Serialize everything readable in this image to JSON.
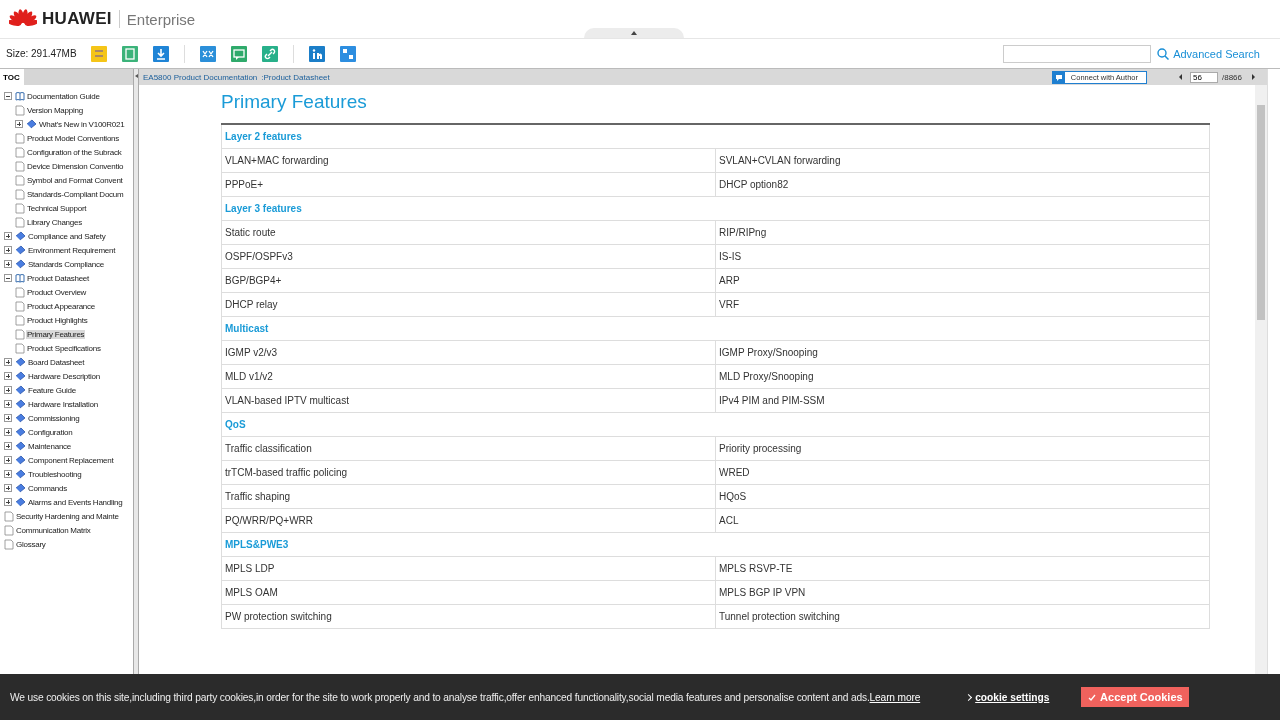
{
  "header": {
    "brand": "HUAWEI",
    "subtitle": "Enterprise"
  },
  "toolbar": {
    "size_label": "Size: 291.47MB",
    "advanced_search": "Advanced Search"
  },
  "toc": {
    "tab": "TOC",
    "items": [
      {
        "kind": "book",
        "label": "Documentation Guide",
        "expanded": true,
        "selected": false,
        "children": [
          {
            "kind": "page",
            "label": "Version Mapping",
            "selected": false
          },
          {
            "kind": "folder",
            "label": "What's New in V100R021",
            "expanded": false,
            "selected": false
          },
          {
            "kind": "page",
            "label": "Product Model Conventions",
            "selected": false
          },
          {
            "kind": "page",
            "label": "Configuration of the Subrack",
            "selected": false
          },
          {
            "kind": "page",
            "label": "Device Dimension Conventio",
            "selected": false
          },
          {
            "kind": "page",
            "label": "Symbol and Format Convent",
            "selected": false
          },
          {
            "kind": "page",
            "label": "Standards-Compliant Docum",
            "selected": false
          },
          {
            "kind": "page",
            "label": "Technical Support",
            "selected": false
          },
          {
            "kind": "page",
            "label": "Library Changes",
            "selected": false
          }
        ]
      },
      {
        "kind": "folder",
        "label": "Compliance and Safety",
        "expanded": false,
        "selected": false
      },
      {
        "kind": "folder",
        "label": "Environment Requirement",
        "expanded": false,
        "selected": false
      },
      {
        "kind": "folder",
        "label": "Standards Compliance",
        "expanded": false,
        "selected": false
      },
      {
        "kind": "book",
        "label": "Product Datasheet",
        "expanded": true,
        "selected": false,
        "children": [
          {
            "kind": "page",
            "label": "Product Overview",
            "selected": false
          },
          {
            "kind": "page",
            "label": "Product Appearance",
            "selected": false
          },
          {
            "kind": "page",
            "label": "Product Highlights",
            "selected": false
          },
          {
            "kind": "page",
            "label": "Primary Features",
            "selected": true
          },
          {
            "kind": "page",
            "label": "Product Specifications",
            "selected": false
          }
        ]
      },
      {
        "kind": "folder",
        "label": "Board Datasheet",
        "expanded": false,
        "selected": false
      },
      {
        "kind": "folder",
        "label": "Hardware Description",
        "expanded": false,
        "selected": false
      },
      {
        "kind": "folder",
        "label": "Feature Guide",
        "expanded": false,
        "selected": false
      },
      {
        "kind": "folder",
        "label": "Hardware Installation",
        "expanded": false,
        "selected": false
      },
      {
        "kind": "folder",
        "label": "Commissioning",
        "expanded": false,
        "selected": false
      },
      {
        "kind": "folder",
        "label": "Configuration",
        "expanded": false,
        "selected": false
      },
      {
        "kind": "folder",
        "label": "Maintenance",
        "expanded": false,
        "selected": false
      },
      {
        "kind": "folder",
        "label": "Component Replacement",
        "expanded": false,
        "selected": false
      },
      {
        "kind": "folder",
        "label": "Troubleshooting",
        "expanded": false,
        "selected": false
      },
      {
        "kind": "folder",
        "label": "Commands",
        "expanded": false,
        "selected": false
      },
      {
        "kind": "folder",
        "label": "Alarms and Events Handling",
        "expanded": false,
        "selected": false
      },
      {
        "kind": "page",
        "label": "Security Hardening and Mainte",
        "selected": false
      },
      {
        "kind": "page",
        "label": "Communication Matrix",
        "selected": false
      },
      {
        "kind": "page",
        "label": "Glossary",
        "selected": false
      }
    ]
  },
  "breadcrumb": [
    "EA5800 Product Documentation",
    ":Product Datasheet"
  ],
  "connect_button": "Connect with Author",
  "pager": {
    "page": "56",
    "total": "/8866"
  },
  "document": {
    "title": "Primary Features",
    "sections": [
      {
        "heading": "Layer 2 features",
        "rows": [
          [
            "VLAN+MAC forwarding",
            "SVLAN+CVLAN forwarding"
          ],
          [
            "PPPoE+",
            "DHCP option82"
          ]
        ]
      },
      {
        "heading": "Layer 3 features",
        "rows": [
          [
            "Static route",
            "RIP/RIPng"
          ],
          [
            "OSPF/OSPFv3",
            "IS-IS"
          ],
          [
            "BGP/BGP4+",
            "ARP"
          ],
          [
            "DHCP relay",
            "VRF"
          ]
        ]
      },
      {
        "heading": "Multicast",
        "rows": [
          [
            "IGMP v2/v3",
            "IGMP Proxy/Snooping"
          ],
          [
            "MLD v1/v2",
            "MLD Proxy/Snooping"
          ],
          [
            "VLAN-based IPTV multicast",
            "IPv4 PIM and PIM-SSM"
          ]
        ]
      },
      {
        "heading": "QoS",
        "rows": [
          [
            "Traffic classification",
            "Priority processing"
          ],
          [
            "trTCM-based traffic policing",
            "WRED"
          ],
          [
            "Traffic shaping",
            "HQoS"
          ],
          [
            "PQ/WRR/PQ+WRR",
            "ACL"
          ]
        ]
      },
      {
        "heading": "MPLS&PWE3",
        "rows": [
          [
            "MPLS LDP",
            "MPLS RSVP-TE"
          ],
          [
            "MPLS OAM",
            "MPLS BGP IP VPN"
          ],
          [
            "PW protection switching",
            "Tunnel protection switching"
          ]
        ]
      }
    ]
  },
  "cookie_banner": {
    "text": "We use cookies on this site,including third party cookies,in order for the site to work properly and to analyse traffic,offer enhanced functionality,social media features and personalise content and ads.",
    "link": "Learn more",
    "settings": "cookie settings",
    "accept": "Accept Cookies"
  }
}
